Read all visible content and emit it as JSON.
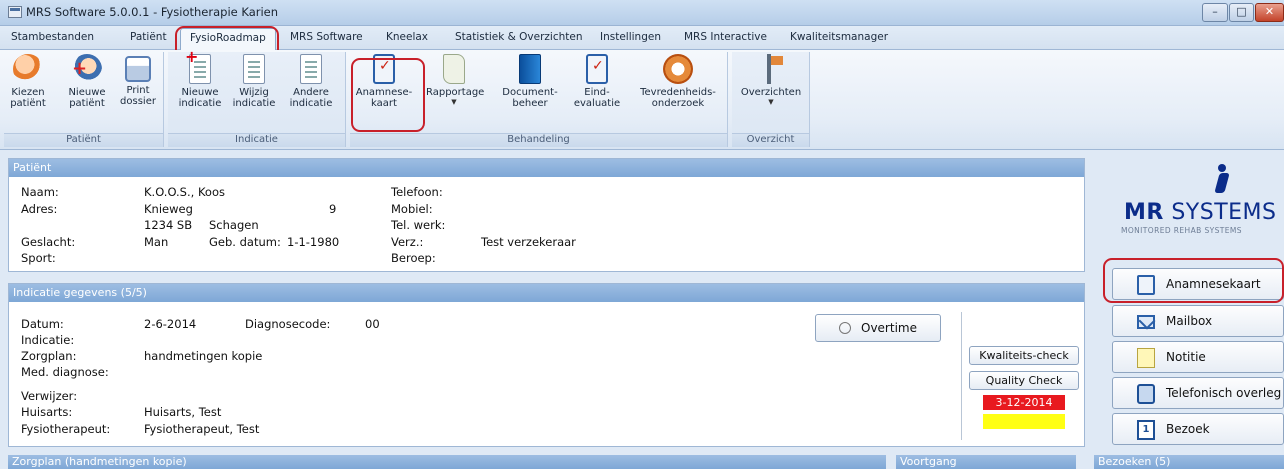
{
  "window": {
    "title": "MRS Software 5.0.0.1 - Fysiotherapie Karien",
    "min": "–",
    "max": "□",
    "close": "✕"
  },
  "menu": {
    "tabs": [
      "Stambestanden",
      "Patiënt",
      "FysioRoadmap",
      "MRS Software",
      "Kneelax",
      "Statistiek & Overzichten",
      "Instellingen",
      "MRS Interactive",
      "Kwaliteitsmanager"
    ],
    "active": "FysioRoadmap"
  },
  "ribbon": {
    "groups": {
      "patient": "Patiënt",
      "indicatie": "Indicatie",
      "behandeling": "Behandeling",
      "overzicht": "Overzicht"
    },
    "buttons": {
      "kiezen": [
        "Kiezen",
        "patiënt"
      ],
      "nieuwe_patient": [
        "Nieuwe",
        "patiënt"
      ],
      "print": [
        "Print",
        "dossier"
      ],
      "nieuwe_indicatie": [
        "Nieuwe",
        "indicatie"
      ],
      "wijzig": [
        "Wijzig",
        "indicatie"
      ],
      "andere": [
        "Andere",
        "indicatie"
      ],
      "anamnese": [
        "Anamnese-",
        "kaart"
      ],
      "rapportage": [
        "Rapportage",
        ""
      ],
      "document": [
        "Document-",
        "beheer"
      ],
      "eind": [
        "Eind-",
        "evaluatie"
      ],
      "tevreden": [
        "Tevredenheids-",
        "onderzoek"
      ],
      "overzichten": [
        "Overzichten",
        ""
      ]
    },
    "dropdown_arrow": "▼"
  },
  "patient": {
    "header": "Patiënt",
    "naam_label": "Naam:",
    "naam": "K.O.O.S., Koos",
    "adres_label": "Adres:",
    "straat": "Knieweg",
    "huisnummer": "9",
    "postcode": "1234 SB",
    "plaats": "Schagen",
    "geslacht_label": "Geslacht:",
    "geslacht": "Man",
    "gebdatum_label": "Geb. datum:",
    "gebdatum": "1-1-1980",
    "sport_label": "Sport:",
    "telefoon_label": "Telefoon:",
    "mobiel_label": "Mobiel:",
    "telwerk_label": "Tel. werk:",
    "verz_label": "Verz.:",
    "verz": "Test verzekeraar",
    "beroep_label": "Beroep:"
  },
  "indicatie": {
    "header": "Indicatie gegevens (5/5)",
    "datum_label": "Datum:",
    "datum": "2-6-2014",
    "diagnosecode_label": "Diagnosecode:",
    "diagnosecode": "00",
    "indicatie_label": "Indicatie:",
    "zorgplan_label": "Zorgplan:",
    "zorgplan": "handmetingen kopie",
    "med_label": "Med. diagnose:",
    "verwijzer_label": "Verwijzer:",
    "huisarts_label": "Huisarts:",
    "huisarts": "Huisarts, Test",
    "fysio_label": "Fysiotherapeut:",
    "fysio": "Fysiotherapeut, Test",
    "overtime_button": "Overtime",
    "kwaliteits_button": "Kwaliteits-check",
    "quality_button": "Quality Check",
    "date_badge": "3-12-2014",
    "date_badge_color": "#e8191f",
    "yellow_badge_color": "#ffff14"
  },
  "side": {
    "logo_bold": "MR",
    "logo_rest": " SYSTEMS",
    "logo_sub": "MONITORED REHAB SYSTEMS",
    "buttons": [
      "Anamnesekaart",
      "Mailbox",
      "Notitie",
      "Telefonisch overleg",
      "Bezoek"
    ],
    "bezoek_icon_text": "1"
  },
  "bottom": {
    "zorgplan": "Zorgplan (handmetingen kopie)",
    "voortgang": "Voortgang",
    "bezoeken": "Bezoeken (5)"
  },
  "colors": {
    "highlight": "#c8202a",
    "panel_header": "#8fb2dc",
    "accent_blue": "#0b2c8a"
  }
}
